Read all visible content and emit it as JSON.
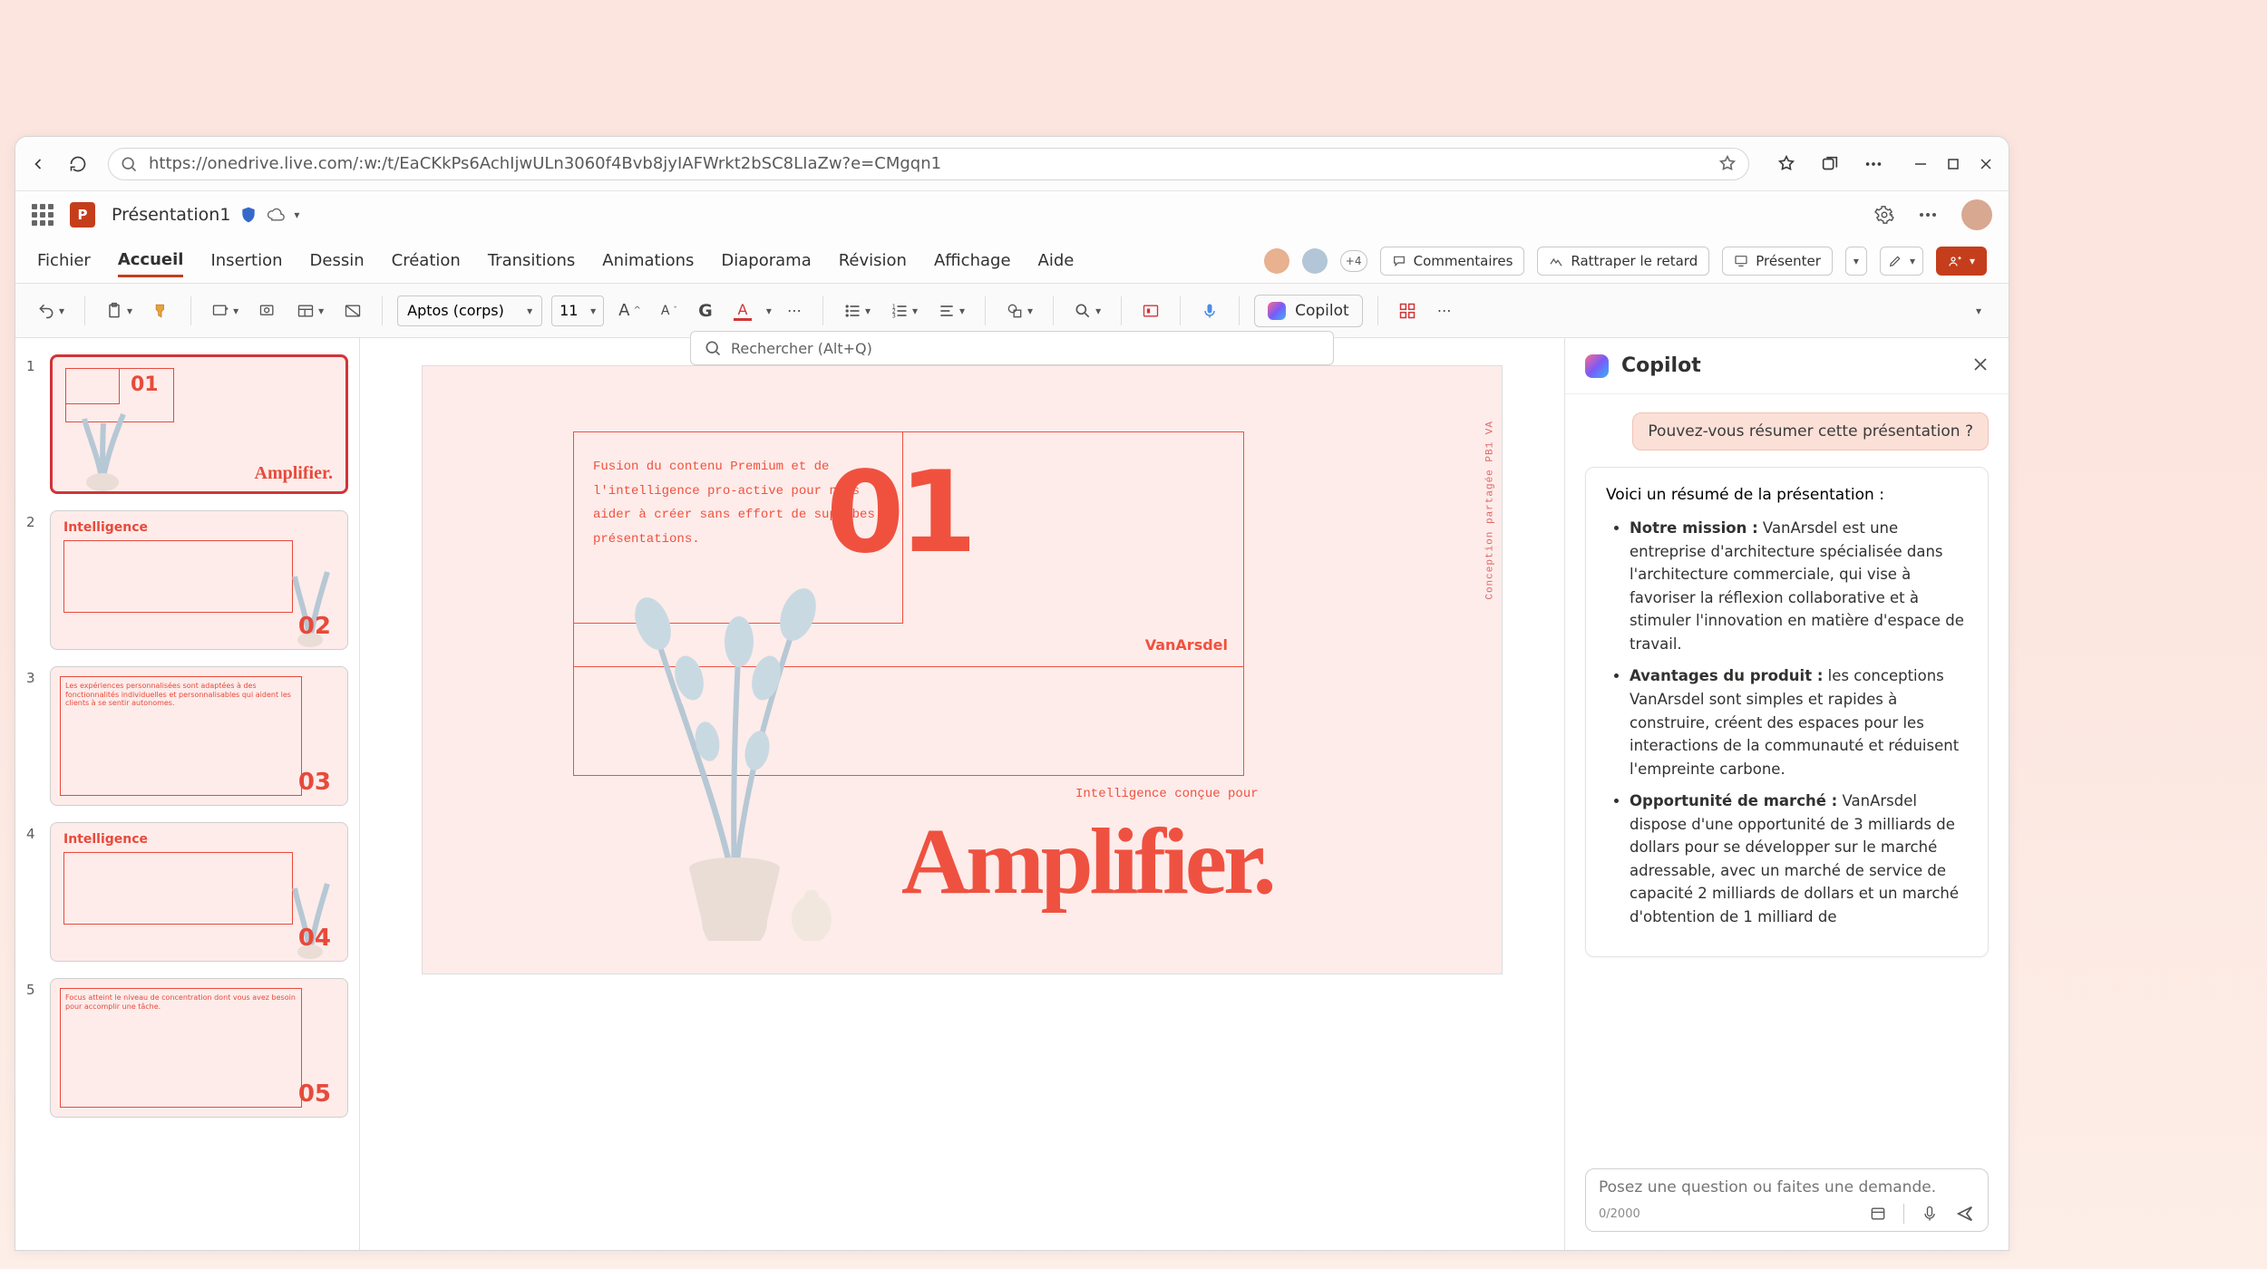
{
  "browser": {
    "url": "https://onedrive.live.com/:w:/t/EaCKkPs6AchIjwULn3060f4Bvb8jyIAFWrkt2bSC8LIaZw?e=CMgqn1"
  },
  "header": {
    "doc_title": "Présentation1",
    "search_placeholder": "Rechercher (Alt+Q)"
  },
  "tabs": {
    "file": "Fichier",
    "home": "Accueil",
    "insert": "Insertion",
    "draw": "Dessin",
    "design": "Création",
    "transitions": "Transitions",
    "animations": "Animations",
    "slideshow": "Diaporama",
    "review": "Révision",
    "view": "Affichage",
    "help": "Aide",
    "plus_badge": "+4",
    "comments": "Commentaires",
    "catchup": "Rattraper le retard",
    "present": "Présenter"
  },
  "toolbar": {
    "font_name": "Aptos (corps)",
    "font_size": "11",
    "copilot_label": "Copilot"
  },
  "thumbnails": [
    {
      "num": "1",
      "big_num_small": "01",
      "title_big": "Amplifier.",
      "kind": "cover"
    },
    {
      "num": "2",
      "label": "Intelligence",
      "corner_num": "02"
    },
    {
      "num": "3",
      "body": "Les expériences personnalisées sont adaptées à des fonctionnalités individuelles et personnalisables qui aident les clients à se sentir autonomes.",
      "corner_num": "03"
    },
    {
      "num": "4",
      "label": "Intelligence",
      "corner_num": "04"
    },
    {
      "num": "5",
      "body": "Focus atteint le niveau de concentration dont vous avez besoin pour accomplir une tâche.",
      "corner_num": "05"
    }
  ],
  "slide": {
    "big_number": "01",
    "paragraph": "Fusion du contenu Premium et de l'intelligence pro-active pour nous aider à créer sans effort de superbes présentations.",
    "brand": "VanArsdel",
    "subhead": "Intelligence conçue pour",
    "title": "Amplifier.",
    "side_text": "Conception partagée PB1 VA"
  },
  "copilot": {
    "title": "Copilot",
    "user_msg": "Pouvez-vous résumer cette présentation ?",
    "lead": "Voici un résumé de la présentation :",
    "bullets": [
      {
        "bold": "Notre mission :",
        "text": " VanArsdel est une entreprise d'architecture spécialisée dans l'architecture commerciale, qui vise à favoriser la réflexion collaborative et à stimuler l'innovation en matière d'espace de travail."
      },
      {
        "bold": "Avantages du produit :",
        "text": " les conceptions VanArsdel sont simples et rapides à construire, créent des espaces pour les interactions de la communauté et réduisent l'empreinte carbone."
      },
      {
        "bold": "Opportunité de marché :",
        "text": " VanArsdel dispose d'une opportunité de 3 milliards de dollars pour se développer sur le marché adressable, avec un marché de service de capacité 2 milliards de dollars et un marché d'obtention de 1 milliard de"
      }
    ],
    "input_placeholder": "Posez une question ou faites une demande.",
    "counter": "0/2000"
  }
}
